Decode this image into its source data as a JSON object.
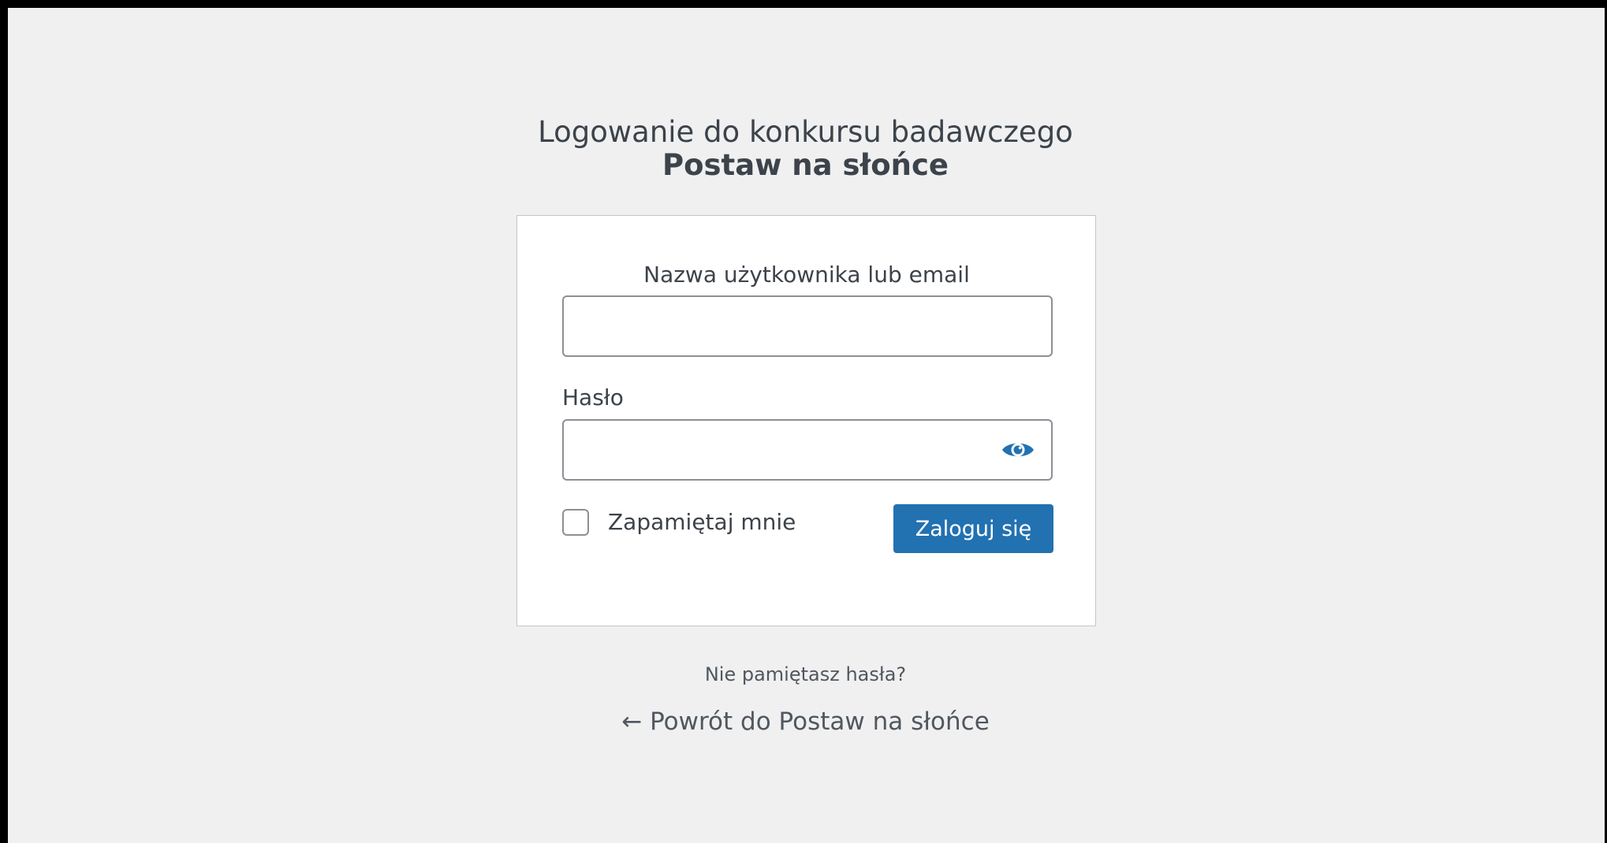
{
  "header": {
    "title_line1": "Logowanie do konkursu badawczego",
    "title_line2": "Postaw na słońce"
  },
  "form": {
    "username_label": "Nazwa użytkownika lub email",
    "username_value": "",
    "password_label": "Hasło",
    "password_value": "",
    "show_password_icon": "eye-icon",
    "remember_label": "Zapamiętaj mnie",
    "remember_checked": false,
    "submit_label": "Zaloguj się"
  },
  "links": {
    "lost_password": "Nie pamiętasz hasła?",
    "back_to_site": "← Powrót do Postaw na słońce"
  },
  "colors": {
    "background": "#f0f0f1",
    "card": "#ffffff",
    "primary": "#2271b1",
    "text": "#3c434a",
    "link": "#50575e"
  }
}
